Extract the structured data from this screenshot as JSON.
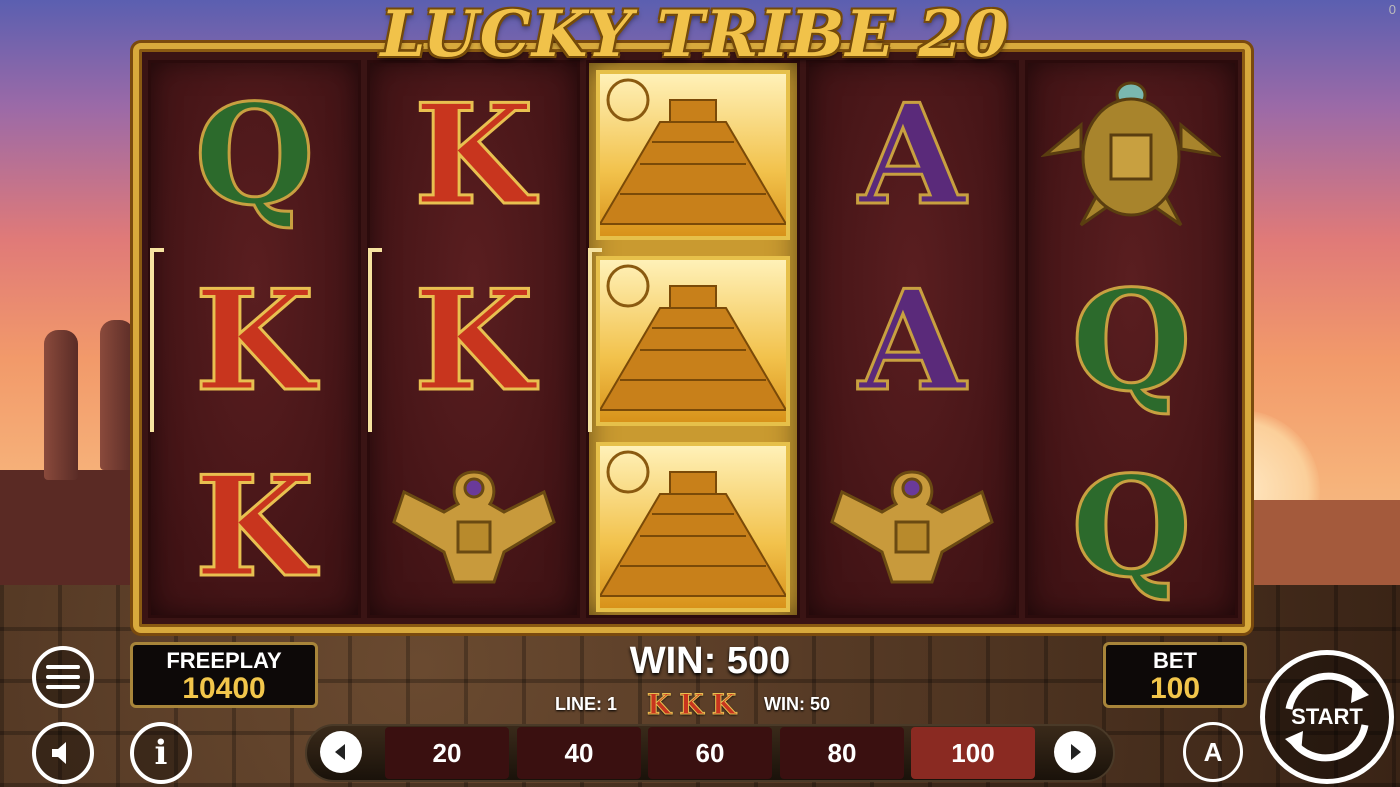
{
  "game": {
    "title": "LUCKY TRIBE 20",
    "corner_counter": "0"
  },
  "reels": [
    [
      {
        "type": "letter",
        "value": "Q",
        "color": "green"
      },
      {
        "type": "letter",
        "value": "K",
        "color": "red"
      },
      {
        "type": "letter",
        "value": "K",
        "color": "red"
      }
    ],
    [
      {
        "type": "letter",
        "value": "K",
        "color": "red"
      },
      {
        "type": "letter",
        "value": "K",
        "color": "red"
      },
      {
        "type": "icon",
        "value": "eagle-totem-icon"
      }
    ],
    [
      {
        "type": "icon",
        "value": "pyramid-icon"
      },
      {
        "type": "icon",
        "value": "pyramid-icon"
      },
      {
        "type": "icon",
        "value": "pyramid-icon"
      }
    ],
    [
      {
        "type": "letter",
        "value": "A",
        "color": "purple"
      },
      {
        "type": "letter",
        "value": "A",
        "color": "purple"
      },
      {
        "type": "icon",
        "value": "eagle-totem-icon"
      }
    ],
    [
      {
        "type": "icon",
        "value": "turtle-icon"
      },
      {
        "type": "letter",
        "value": "Q",
        "color": "green"
      },
      {
        "type": "letter",
        "value": "Q",
        "color": "green"
      }
    ]
  ],
  "balance": {
    "label": "FREEPLAY",
    "value": "10400"
  },
  "win": {
    "label": "WIN: 500"
  },
  "line_win": {
    "line_label": "LINE: 1",
    "symbols": [
      "K",
      "K",
      "K"
    ],
    "win_label": "WIN: 50"
  },
  "bet": {
    "label": "BET",
    "value": "100"
  },
  "bet_options": [
    "20",
    "40",
    "60",
    "80",
    "100"
  ],
  "selected_bet": "100",
  "controls": {
    "start_label": "START",
    "auto_label": "A",
    "info_label": "i"
  }
}
